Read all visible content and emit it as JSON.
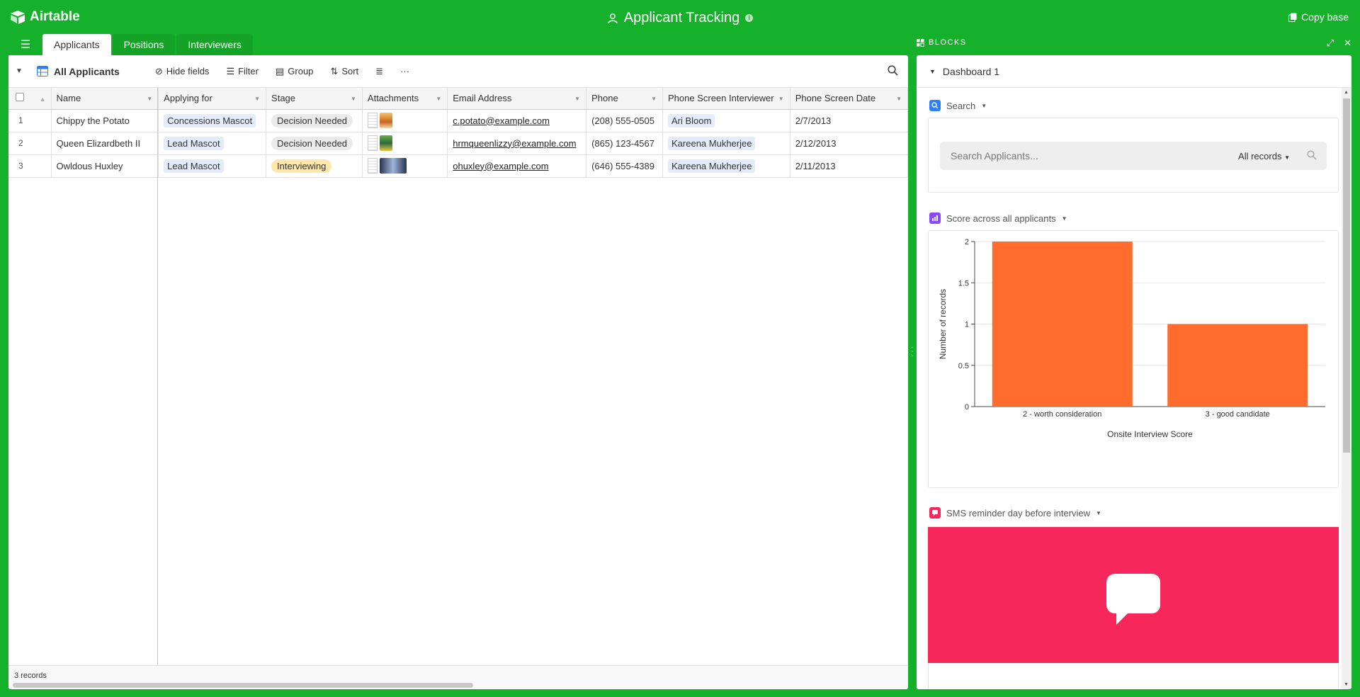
{
  "app": {
    "name": "Airtable",
    "base_title": "Applicant Tracking",
    "copy_base": "Copy base"
  },
  "tables": [
    "Applicants",
    "Positions",
    "Interviewers"
  ],
  "active_table": "Applicants",
  "blocks_label": "BLOCKS",
  "toolbar": {
    "view_name": "All Applicants",
    "hide_fields": "Hide fields",
    "filter": "Filter",
    "group": "Group",
    "sort": "Sort"
  },
  "grid": {
    "columns": [
      "Name",
      "Applying for",
      "Stage",
      "Attachments",
      "Email Address",
      "Phone",
      "Phone Screen Interviewer",
      "Phone Screen Date"
    ],
    "rows": [
      {
        "num": "1",
        "name": "Chippy the Potato",
        "applying_for": "Concessions Mascot",
        "stage": "Decision Needed",
        "email": "c.potato@example.com",
        "phone": "(208) 555-0505",
        "interviewer": "Ari Bloom",
        "date": "2/7/2013"
      },
      {
        "num": "2",
        "name": "Queen Elizardbeth II",
        "applying_for": "Lead Mascot",
        "stage": "Decision Needed",
        "email": "hrmqueenlizzy@example.com",
        "phone": "(865) 123-4567",
        "interviewer": "Kareena Mukherjee",
        "date": "2/12/2013"
      },
      {
        "num": "3",
        "name": "Owldous Huxley",
        "applying_for": "Lead Mascot",
        "stage": "Interviewing",
        "email": "ohuxley@example.com",
        "phone": "(646) 555-4389",
        "interviewer": "Kareena Mukherjee",
        "date": "2/11/2013"
      }
    ],
    "record_count": "3 records"
  },
  "dashboard": {
    "name": "Dashboard 1",
    "search_block": {
      "title": "Search",
      "placeholder": "Search Applicants...",
      "scope": "All records"
    },
    "chart_block": {
      "title": "Score across all applicants"
    },
    "sms_block": {
      "title": "SMS reminder day before interview",
      "color": "#f7275c"
    }
  },
  "chart_data": {
    "type": "bar",
    "categories": [
      "2 - worth consideration",
      "3 - good candidate"
    ],
    "values": [
      2,
      1
    ],
    "title": "",
    "xlabel": "Onsite Interview Score",
    "ylabel": "Number of records",
    "ylim": [
      0,
      2
    ],
    "yticks": [
      "0",
      "0.5",
      "1",
      "1.5",
      "2"
    ],
    "bar_color": "#ff6c2c",
    "grid": true
  },
  "colors": {
    "background": "#16b12a",
    "chip": "#e4ecfb",
    "stage_pill": "#eaeaea",
    "interviewing_pill": "#ffe8a8"
  }
}
